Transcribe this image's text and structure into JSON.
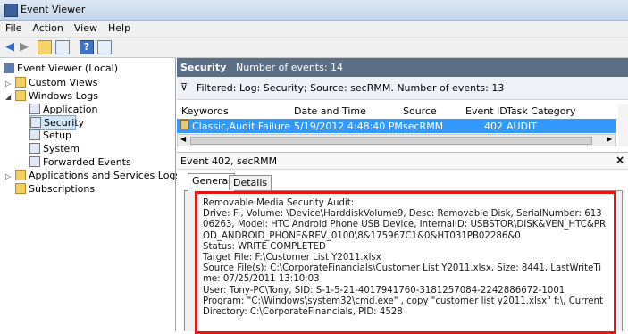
{
  "window": {
    "title": "Event Viewer"
  },
  "menu": {
    "file": "File",
    "action": "Action",
    "view": "View",
    "help": "Help"
  },
  "tree": {
    "root": "Event Viewer (Local)",
    "custom_views": "Custom Views",
    "windows_logs": "Windows Logs",
    "application": "Application",
    "security": "Security",
    "setup": "Setup",
    "system": "System",
    "forwarded": "Forwarded Events",
    "apps_services": "Applications and Services Logs",
    "subscriptions": "Subscriptions"
  },
  "log_header": {
    "name": "Security",
    "count": "Number of events: 14"
  },
  "filter": {
    "text": "Filtered: Log: Security; Source: secRMM. Number of events: 13"
  },
  "columns": {
    "keywords": "Keywords",
    "date_time": "Date and Time",
    "source": "Source",
    "event_id": "Event ID",
    "task_category": "Task Category"
  },
  "selected_row": {
    "keywords": "Classic,Audit Failure",
    "date_time": "5/19/2012 4:48:40 PM",
    "source": "secRMM",
    "event_id": "402",
    "task_category": "AUDIT"
  },
  "event_panel": {
    "title": "Event 402, secRMM",
    "close": "×"
  },
  "tabs": {
    "general": "General",
    "details": "Details"
  },
  "details_text": "Removable Media Security Audit:\nDrive: F:, Volume: \\Device\\HarddiskVolume9, Desc: Removable Disk, SerialNumber: 61306263, Model: HTC Android Phone USB Device, InternalID: USBSTOR\\DISK&VEN_HTC&PROD_ANDROID_PHONE&REV_0100\\8&175967C1&0&HT031PB02286&0\nStatus: WRITE COMPLETED\nTarget File: F:\\Customer List Y2011.xlsx\nSource File(s): C:\\CorporateFinancials\\Customer List Y2011.xlsx, Size: 8441, LastWriteTime: 07/25/2011 13:10:03\nUser: Tony-PC\\Tony, SID: S-1-5-21-4017941760-3181257084-2242886672-1001\nProgram: \"C:\\Windows\\system32\\cmd.exe\" , copy \"customer list y2011.xlsx\" f:\\, Current Directory: C:\\CorporateFinancials, PID: 4528",
  "colors": {
    "selection": "#3399ff",
    "header": "#5a6e86",
    "highlight_border": "#e01818"
  }
}
